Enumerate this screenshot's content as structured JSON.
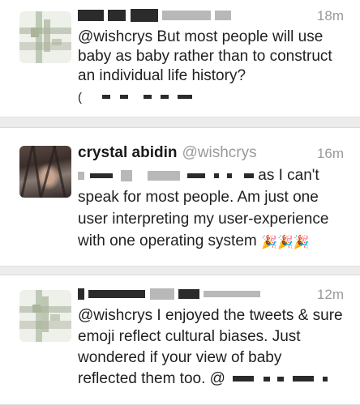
{
  "tweets": [
    {
      "time": "18m",
      "text_lines": [
        "@wishcrys But most people will use",
        "baby as baby rather than to construct",
        "an individual life history?"
      ],
      "trailing_char": "("
    },
    {
      "name": "crystal abidin",
      "handle": "@wishcrys",
      "time": "16m",
      "line1_tail": "as I can't",
      "text_lines": [
        "speak for most people. Am just one",
        "user interpreting my user-experience",
        "with one operating system"
      ],
      "emoji": "🎉🎉🎉"
    },
    {
      "name_fragment": "",
      "time": "12m",
      "text_lines": [
        "@wishcrys I enjoyed the tweets & sure",
        "emoji reflect cultural biases. Just",
        "wondered if your view of baby",
        "reflected them too. @"
      ]
    }
  ]
}
